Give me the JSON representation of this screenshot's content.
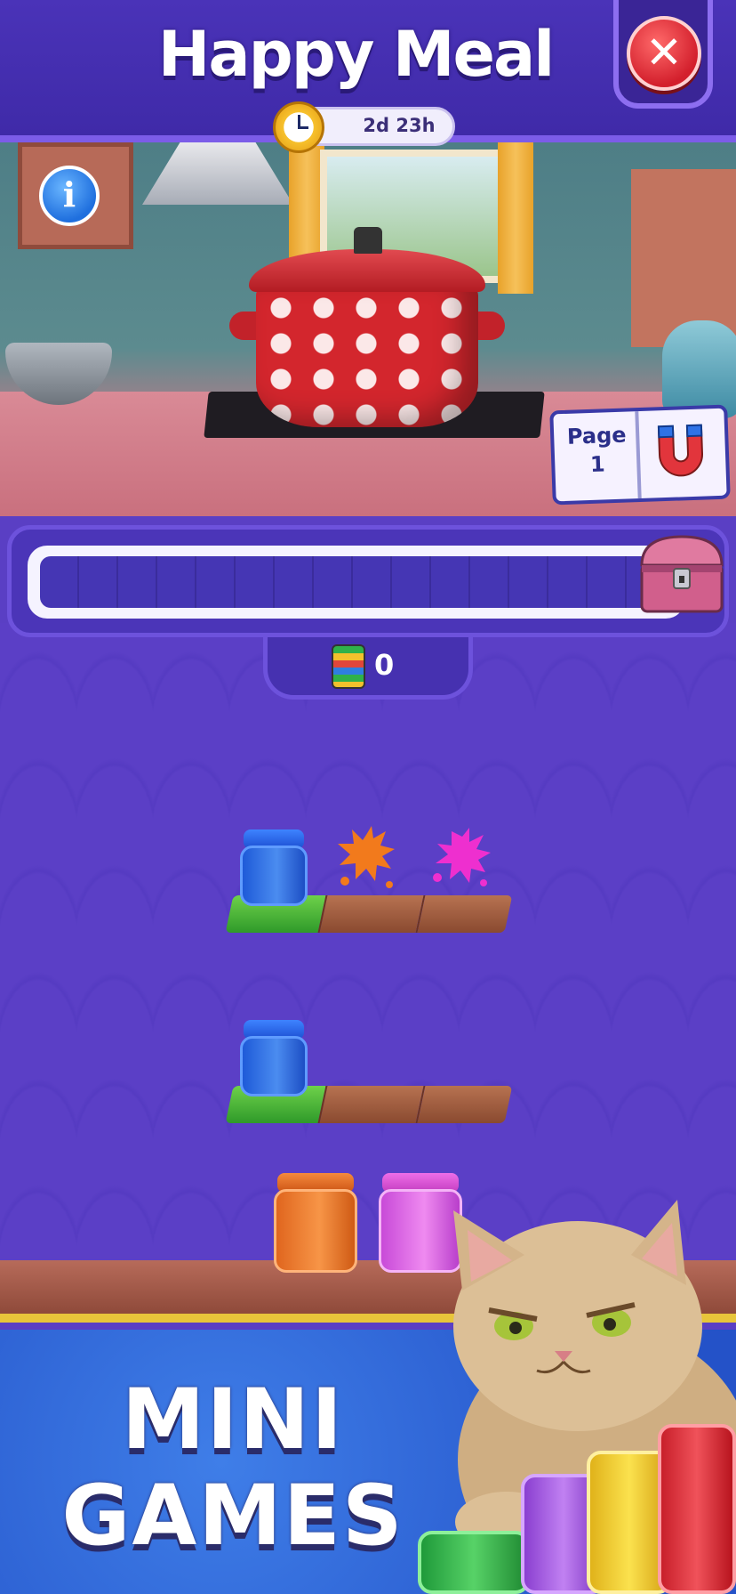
{
  "header": {
    "title": "Happy Meal",
    "close_icon": "close-icon",
    "timer": {
      "icon": "clock-icon",
      "text": "2d 23h"
    }
  },
  "scene": {
    "info_icon": "info-icon",
    "info_label": "i",
    "booster": {
      "label_line1": "Page",
      "label_line2": "1",
      "icon": "magnet-icon"
    }
  },
  "progress": {
    "fraction": 0,
    "segments": 17,
    "reward_icon": "treasure-chest-icon"
  },
  "jar_counter": {
    "icon": "jar-stack-icon",
    "value": "0"
  },
  "play_area": {
    "shelves": [
      {
        "slots": [
          {
            "item": "jar",
            "color": "blue"
          },
          {
            "item": "splat",
            "color": "orange"
          },
          {
            "item": "splat",
            "color": "pink"
          }
        ]
      },
      {
        "slots": [
          {
            "item": "jar",
            "color": "blue"
          },
          {
            "item": "empty"
          },
          {
            "item": "empty"
          }
        ]
      }
    ],
    "tray": [
      {
        "item": "jar",
        "color": "orange"
      },
      {
        "item": "jar",
        "color": "pink"
      }
    ]
  },
  "banner": {
    "line1": "MINI",
    "line2": "GAMES",
    "mascot": "cat-mascot"
  },
  "colors": {
    "background": "#5b3fc6",
    "header": "#4a33b8",
    "accent_border": "#7c5ce8",
    "close_red": "#d31f2c",
    "banner_blue": "#2452c8",
    "shelf_green": "#2f9a2a",
    "shelf_brown": "#8a4a30"
  }
}
